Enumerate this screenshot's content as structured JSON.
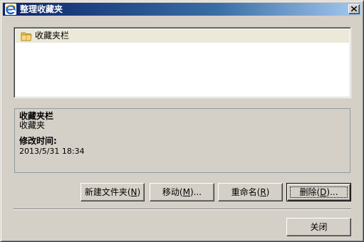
{
  "window": {
    "title": "整理收藏夹",
    "app_icon": "ie-icon",
    "close_icon": "close-icon"
  },
  "tree": {
    "items": [
      {
        "label": "收藏夹栏",
        "icon": "folder-icon",
        "selected": true
      }
    ]
  },
  "details": {
    "name": "收藏夹栏",
    "url": "收藏夹",
    "modified_label": "修改时间:",
    "modified_value": "2013/5/31 18:34"
  },
  "buttons": {
    "new_folder": {
      "text": "新建文件夹(",
      "key": "N",
      "tail": ")"
    },
    "move": {
      "text": "移动(",
      "key": "M",
      "tail": ")..."
    },
    "rename": {
      "text": "重命名(",
      "key": "R",
      "tail": ")"
    },
    "delete": {
      "text": "删除(",
      "key": "D",
      "tail": ")..."
    },
    "close": "关闭"
  },
  "colors": {
    "title_start": "#0a246a",
    "title_end": "#a6caf0",
    "dialog_bg": "#d4d0c8",
    "selection_bg": "#ece9d8"
  }
}
